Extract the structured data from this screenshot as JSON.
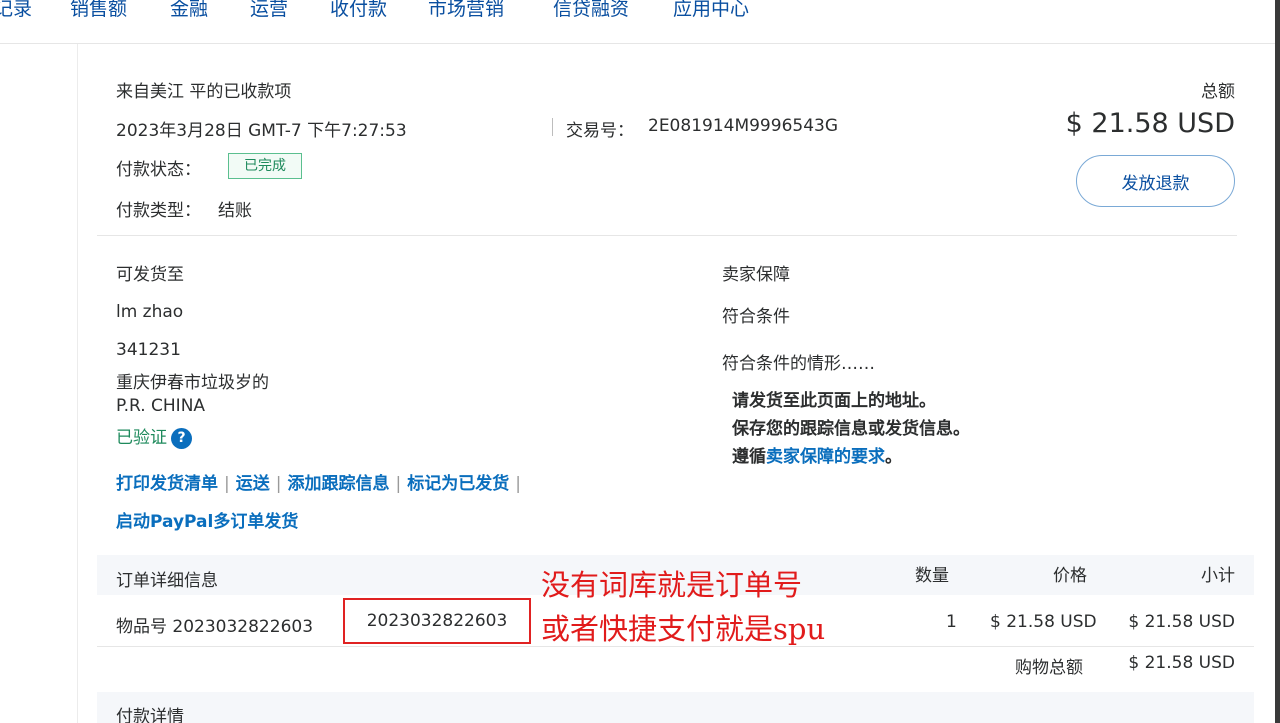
{
  "nav": {
    "items": [
      "记录",
      "销售额",
      "金融",
      "运营",
      "收付款",
      "市场营销",
      "信贷融资",
      "应用中心"
    ]
  },
  "payment": {
    "title": "来自美江 平的已收款项",
    "datetime": "2023年3月28日 GMT-7 下午7:27:53",
    "txn_label": "交易号：",
    "txn_id": "2E081914M9996543G",
    "status_label": "付款状态：",
    "status_value": "已完成",
    "type_label": "付款类型：",
    "type_value": "结账",
    "total_label": "总额",
    "total_amount": "$ 21.58 USD",
    "refund_button": "发放退款"
  },
  "shipping": {
    "heading": "可发货至",
    "name": "lm zhao",
    "postcode": "341231",
    "address": "重庆伊春市垃圾岁的",
    "country": "P.R. CHINA",
    "verified": "已验证",
    "verified_help": "?",
    "actions": [
      "打印发货清单",
      "运送",
      "添加跟踪信息",
      "标记为已发货"
    ],
    "multi_order": "启动PayPal多订单发货"
  },
  "protection": {
    "heading": "卖家保障",
    "eligible": "符合条件",
    "conditions_title": "符合条件的情形……",
    "cond1": "请发货至此页面上的地址。",
    "cond2": "保存您的跟踪信息或发货信息。",
    "cond3_prefix": "遵循",
    "cond3_link": "卖家保障的要求",
    "cond3_suffix": "。"
  },
  "order": {
    "heading": "订单详细信息",
    "col_qty": "数量",
    "col_price": "价格",
    "col_subtotal": "小计",
    "item_label": "物品号 2023032822603",
    "item_code": "2023032822603",
    "qty": "1",
    "price": "$ 21.58 USD",
    "subtotal": "$ 21.58 USD",
    "cart_total_label": "购物总额",
    "cart_total": "$ 21.58 USD"
  },
  "payment_details": {
    "heading": "付款详情"
  },
  "annotation": {
    "line1": "没有词库就是订单号",
    "line2": "或者快捷支付就是spu",
    "color": "#e11b1b"
  }
}
